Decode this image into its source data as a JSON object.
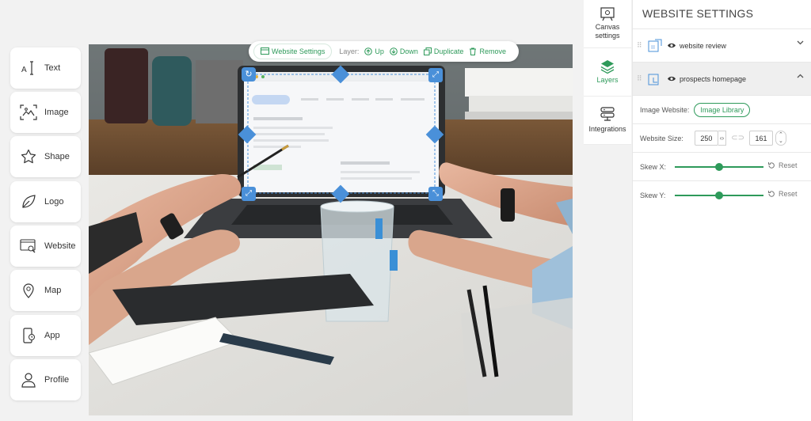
{
  "tools": [
    {
      "label": "Text",
      "icon": "text-cursor-icon"
    },
    {
      "label": "Image",
      "icon": "image-icon"
    },
    {
      "label": "Shape",
      "icon": "star-icon"
    },
    {
      "label": "Logo",
      "icon": "leaf-icon"
    },
    {
      "label": "Website",
      "icon": "browser-search-icon"
    },
    {
      "label": "Map",
      "icon": "map-pin-icon"
    },
    {
      "label": "App",
      "icon": "phone-app-icon"
    },
    {
      "label": "Profile",
      "icon": "person-icon"
    }
  ],
  "toolbar": {
    "website_settings": "Website Settings",
    "layer_label": "Layer:",
    "up": "Up",
    "down": "Down",
    "duplicate": "Duplicate",
    "remove": "Remove"
  },
  "tabs": [
    {
      "label": "Canvas settings",
      "icon": "easel-gear-icon"
    },
    {
      "label": "Layers",
      "icon": "layers-icon",
      "active": true
    },
    {
      "label": "Integrations",
      "icon": "server-icon"
    }
  ],
  "panel": {
    "title": "WEBSITE SETTINGS",
    "layers": [
      {
        "name": "website review",
        "expanded": false
      },
      {
        "name": "prospects homepage",
        "expanded": true
      }
    ],
    "image_website_label": "Image Website:",
    "image_library_button": "Image Library",
    "website_size_label": "Website Size:",
    "width_value": "250",
    "height_value": "161",
    "skew_x_label": "Skew X:",
    "skew_y_label": "Skew Y:",
    "reset_label": "Reset",
    "skew_x_value": 0.5,
    "skew_y_value": 0.5
  },
  "colors": {
    "accent": "#2e9a5a",
    "handle": "#4a90d9"
  }
}
